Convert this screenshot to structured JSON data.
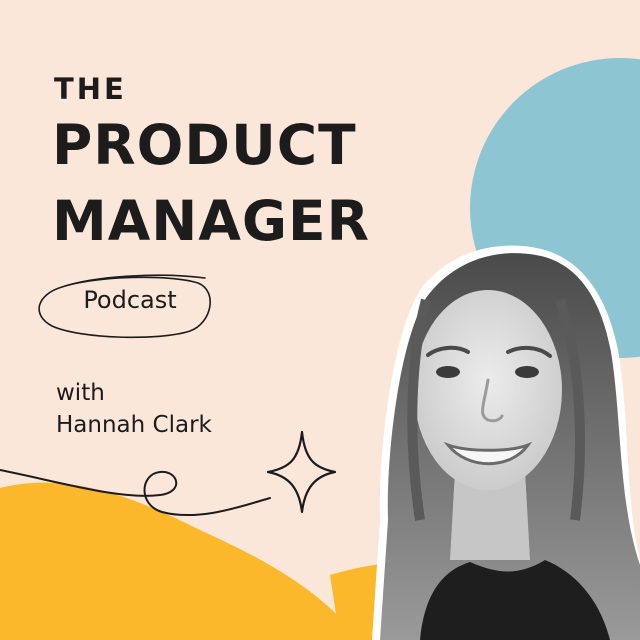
{
  "title": {
    "line1": "THE",
    "line2": "PRODUCT",
    "line3": "MANAGER"
  },
  "badge": "Podcast",
  "host": {
    "line1": "with",
    "line2": "Hannah Clark"
  },
  "colors": {
    "background": "#fbe6da",
    "accent_blue": "#8ec5d3",
    "accent_yellow": "#fbb82b",
    "text": "#1c1c1c"
  },
  "icons": [
    "sparkle-icon",
    "swirl-doodle"
  ]
}
